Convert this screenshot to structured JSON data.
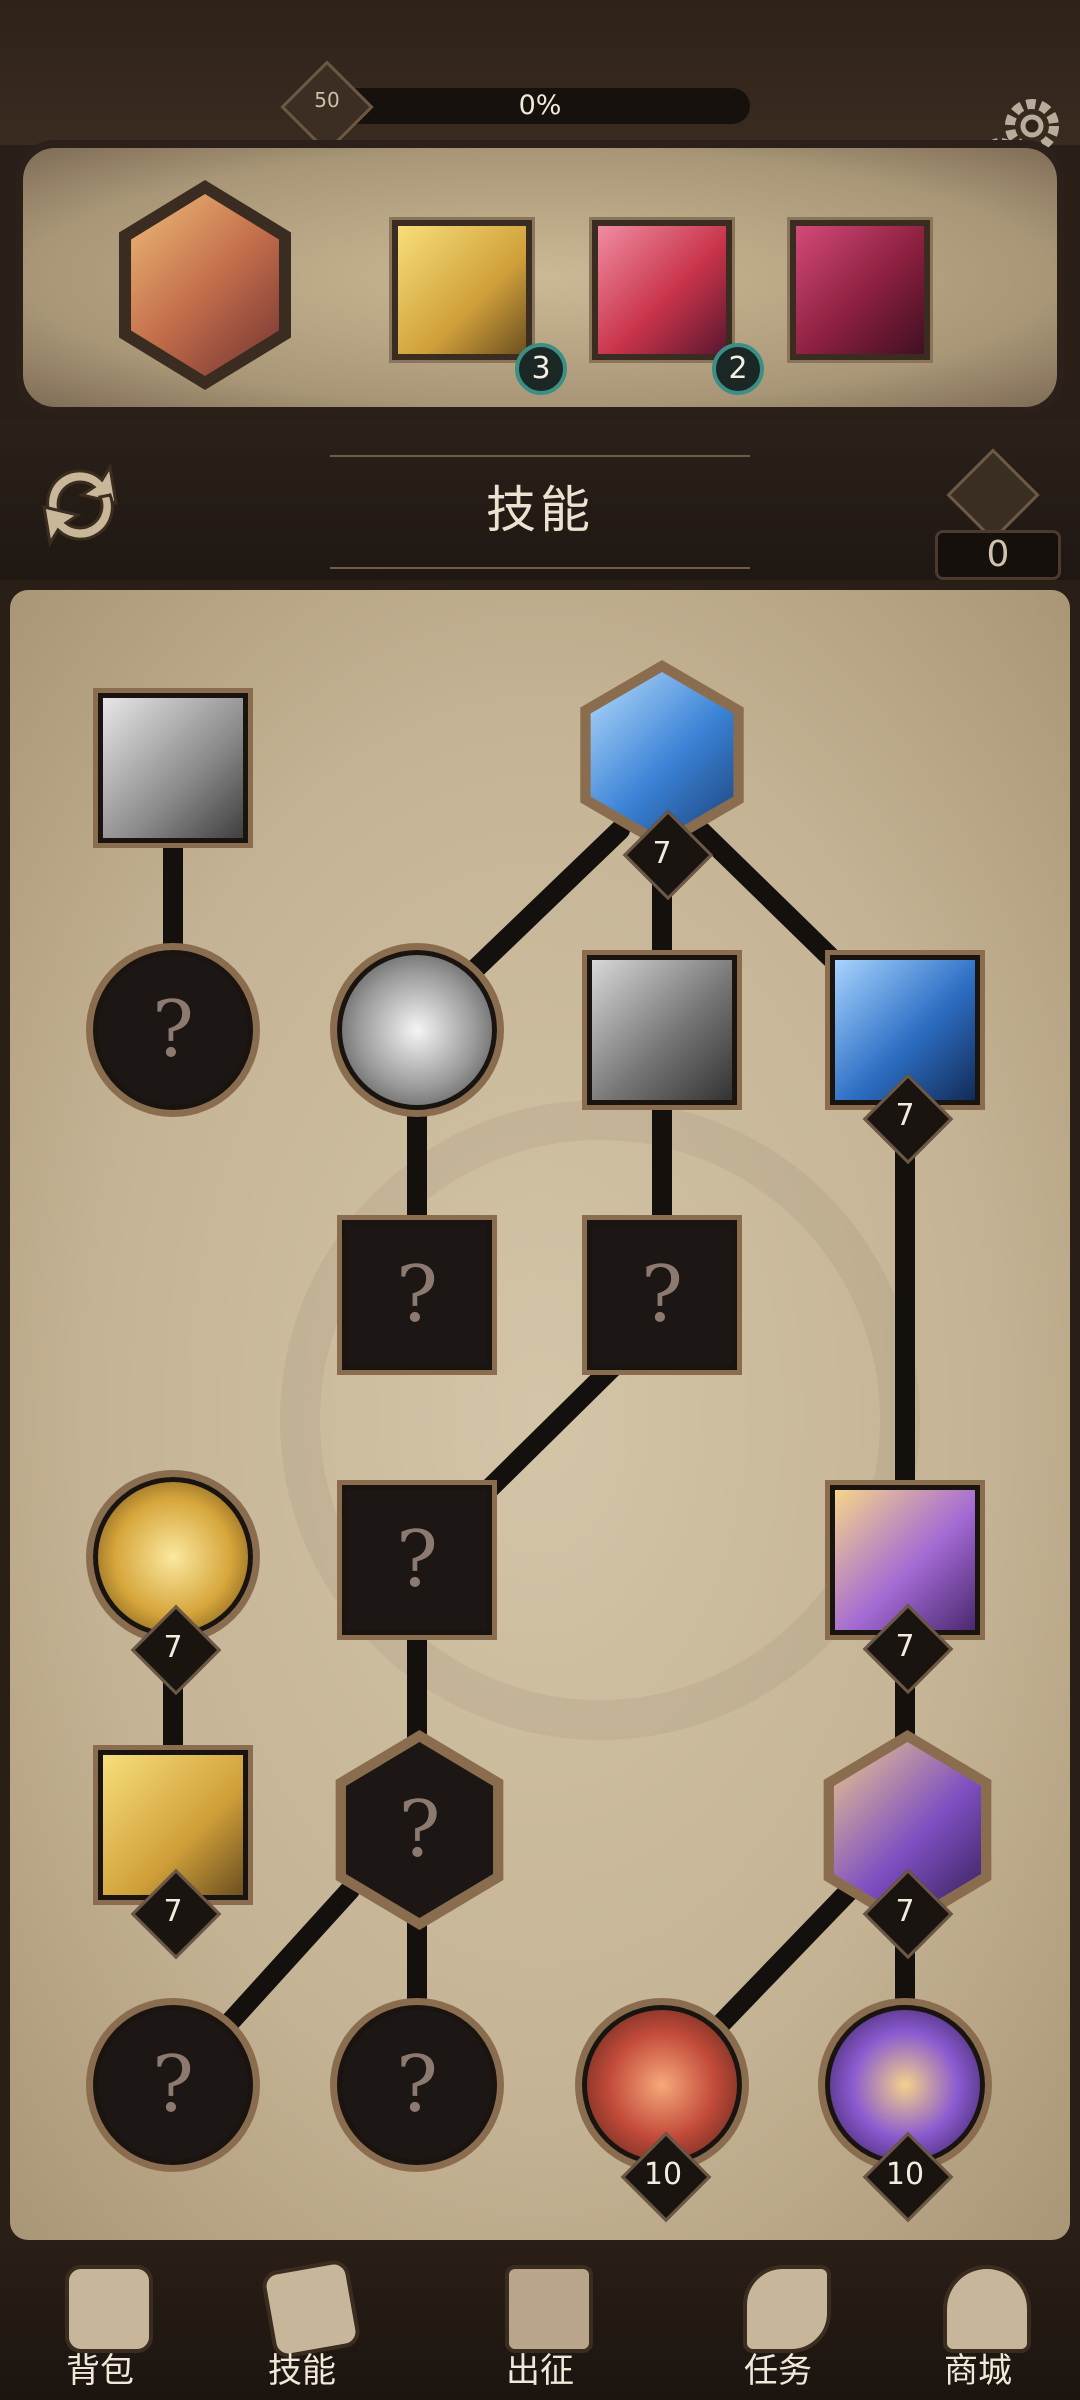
{
  "top": {
    "level": "50",
    "progress_text": "0%",
    "progress": 0
  },
  "equipped": {
    "slots": [
      {
        "name": "equipped-hero",
        "badge": ""
      },
      {
        "name": "equipped-skill-1",
        "badge": "3"
      },
      {
        "name": "equipped-skill-2",
        "badge": "2"
      },
      {
        "name": "equipped-skill-3",
        "badge": ""
      }
    ]
  },
  "header": {
    "title": "技能",
    "points": "0"
  },
  "tree": {
    "unknown": "?",
    "levels": {
      "blue_hex": "7",
      "blue_square": "7",
      "gold_circle": "7",
      "gold_square": "7",
      "purple_square": "7",
      "purple_hex": "7",
      "flame_circle": "10",
      "purple_circle": "10"
    }
  },
  "nav": {
    "items": [
      "背包",
      "技能",
      "出征",
      "任务",
      "商城"
    ]
  },
  "colors": {
    "board": "#c4b394",
    "frame": "#8a6d4f",
    "dark": "#1c1714",
    "badge_ring": "#3c8f84"
  }
}
